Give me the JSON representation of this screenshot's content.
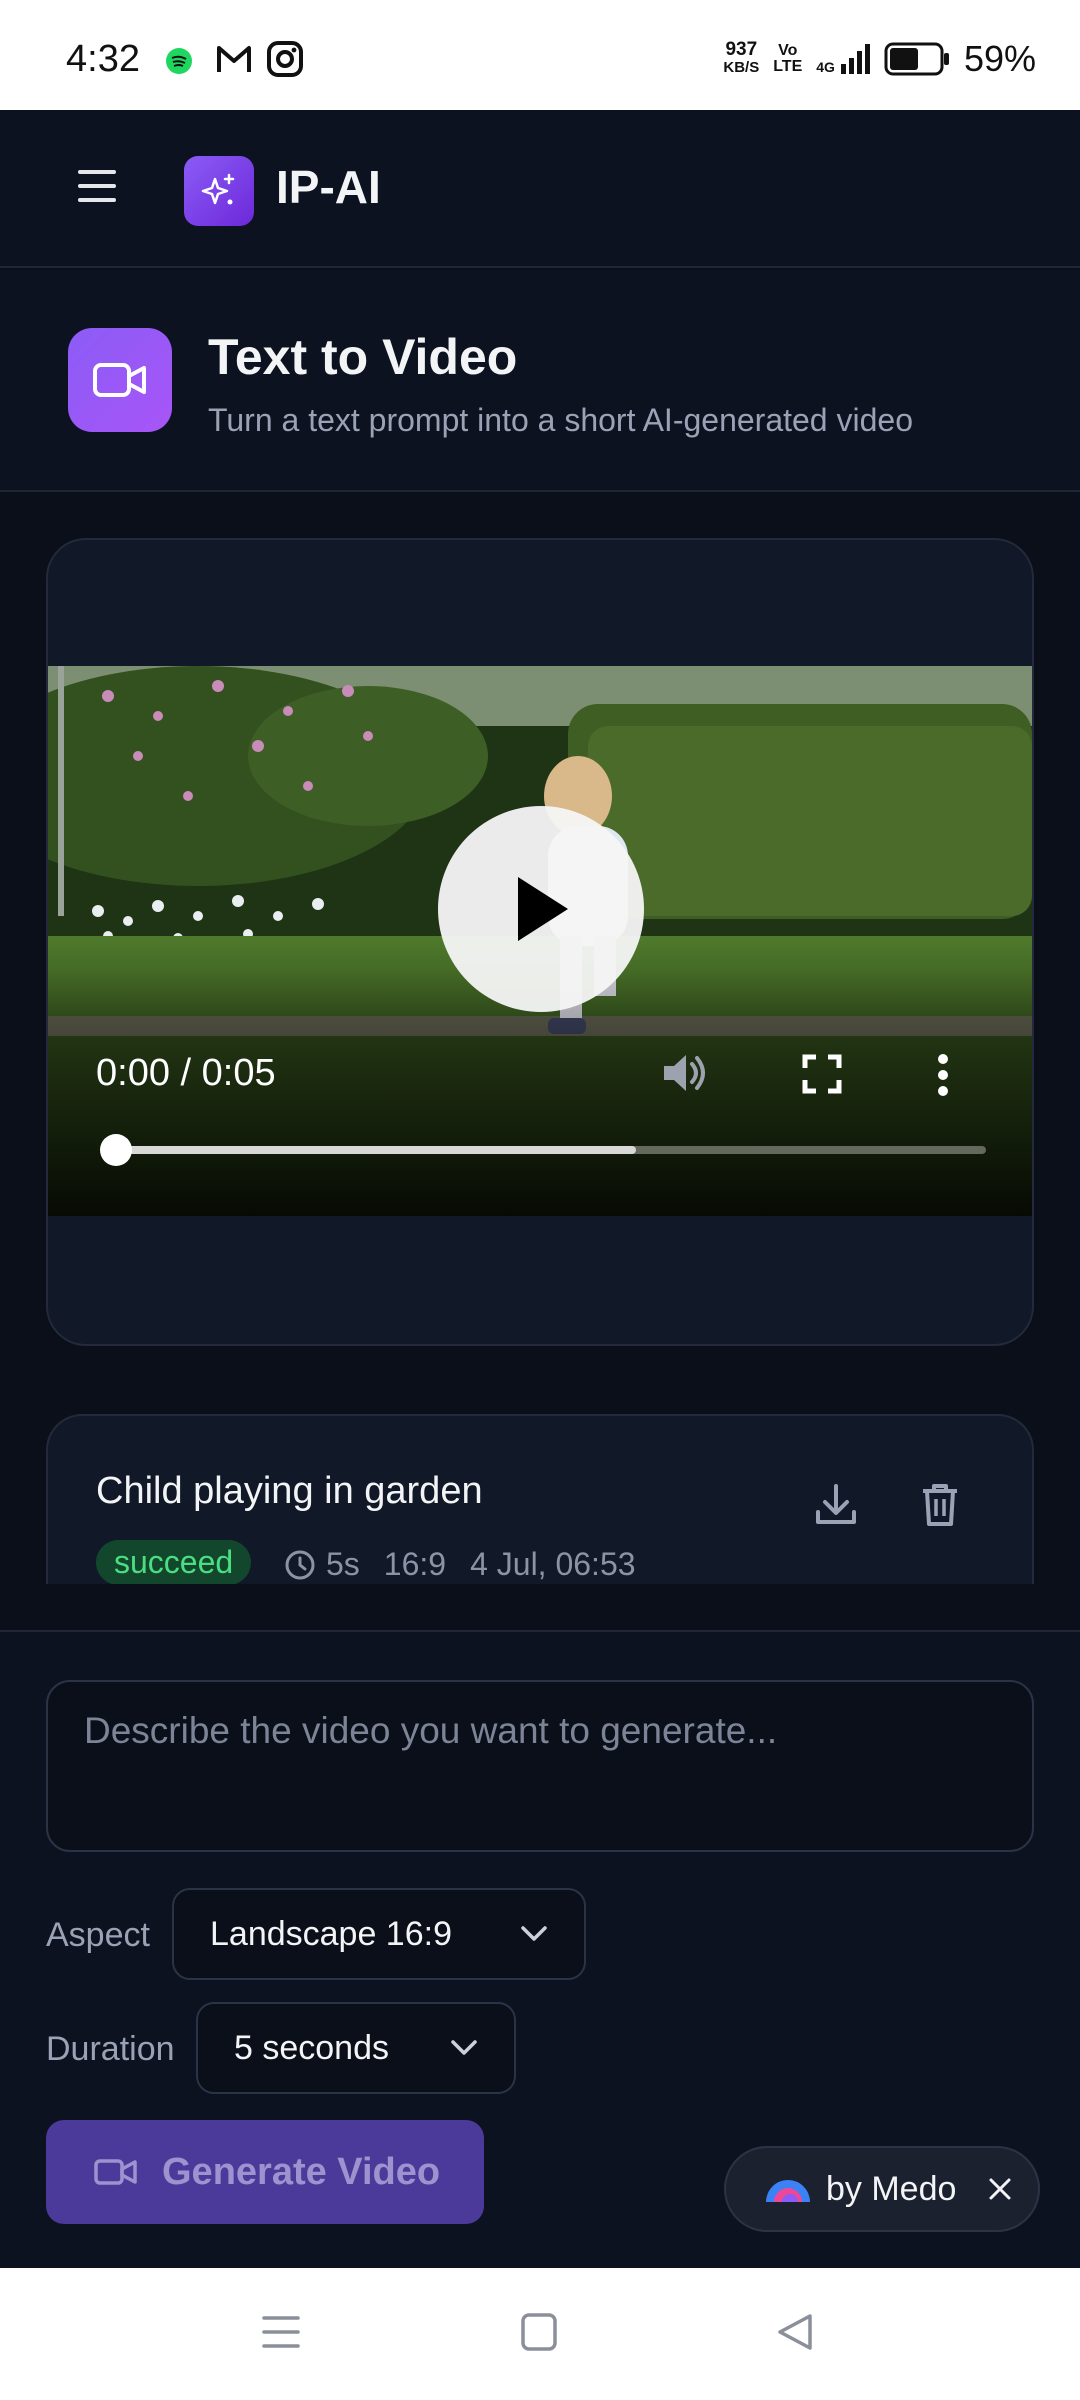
{
  "status_bar": {
    "time": "4:32",
    "speed_value": "937",
    "speed_unit": "KB/S",
    "volte_top": "Vo",
    "volte_bottom": "LTE",
    "network": "4G",
    "battery_percent": "59%",
    "battery_level": 0.59,
    "notification_icons": [
      "spotify-icon",
      "gmail-icon",
      "instagram-icon"
    ]
  },
  "app": {
    "brand": "IP-AI",
    "menu_icon": "hamburger-icon",
    "logo_icon": "sparkles-icon",
    "accent": "#8b5cf6"
  },
  "page": {
    "title": "Text to Video",
    "subtitle": "Turn a text prompt into a short AI-generated video",
    "icon": "video-camera-icon"
  },
  "player": {
    "time_display": "0:00 / 0:05",
    "current_seconds": 0,
    "duration_seconds": 5,
    "buffered_fraction": 0.6,
    "controls": [
      "play-icon",
      "volume-icon",
      "fullscreen-icon",
      "more-vert-icon"
    ]
  },
  "history": {
    "items": [
      {
        "title": "Child playing in garden",
        "status": "succeed",
        "duration": "5s",
        "aspect": "16:9",
        "date": "4 Jul, 06:53",
        "status_color": "#4ade80"
      }
    ]
  },
  "composer": {
    "prompt_placeholder": "Describe the video you want to generate...",
    "prompt_value": "",
    "aspect_label": "Aspect",
    "aspect_value": "Landscape 16:9",
    "duration_label": "Duration",
    "duration_value": "5 seconds",
    "generate_label": "Generate Video"
  },
  "badge": {
    "label": "by Medo"
  },
  "nav": {
    "buttons": [
      "recents-icon",
      "home-icon",
      "back-icon"
    ]
  }
}
